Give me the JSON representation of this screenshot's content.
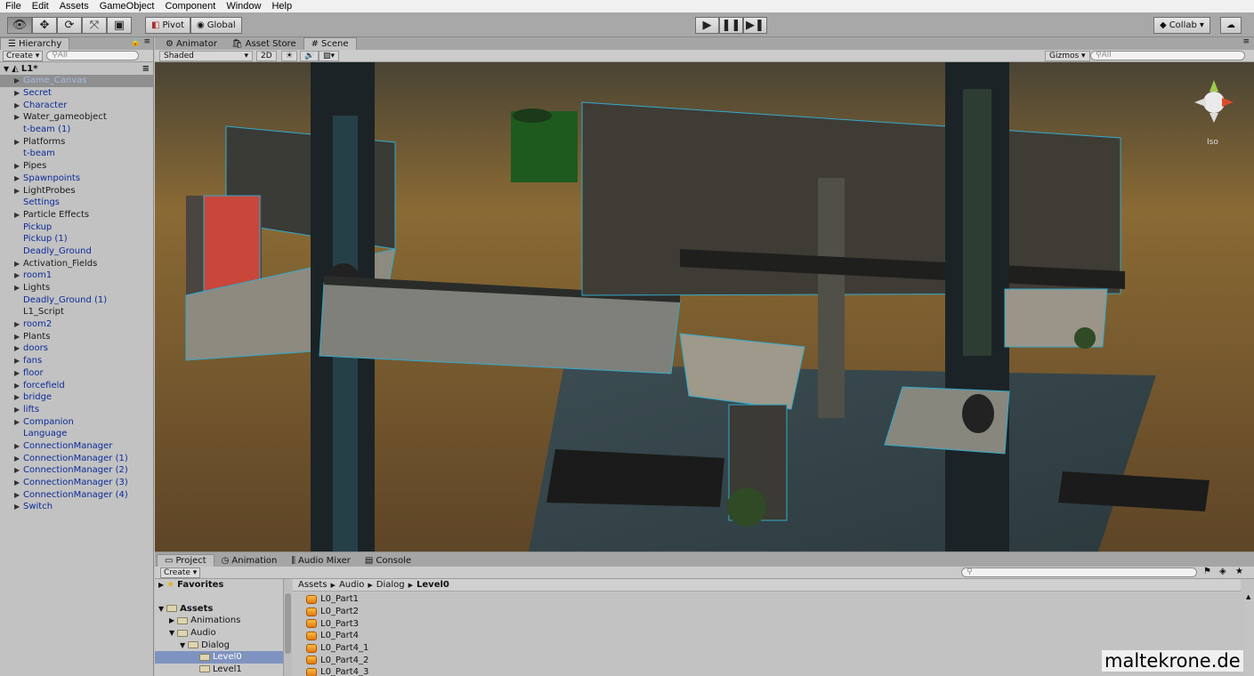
{
  "menu": [
    "File",
    "Edit",
    "Assets",
    "GameObject",
    "Component",
    "Window",
    "Help"
  ],
  "toolbar": {
    "tools": [
      "eye-icon",
      "move-icon",
      "rotate-icon",
      "scale-icon",
      "rect-icon"
    ],
    "pivot": "Pivot",
    "global": "Global",
    "collab": "Collab",
    "play_icons": [
      "play-icon",
      "pause-icon",
      "step-icon"
    ]
  },
  "hierarchy": {
    "tab": "Hierarchy",
    "create": "Create",
    "search_placeholder": "All",
    "scene_name": "L1*",
    "items": [
      {
        "label": "Game_Canvas",
        "expandable": true,
        "selected": true,
        "prefab": true
      },
      {
        "label": "Secret",
        "expandable": true,
        "prefab": true
      },
      {
        "label": "Character",
        "expandable": true,
        "prefab": true
      },
      {
        "label": "Water_gameobject",
        "expandable": true,
        "prefab": false
      },
      {
        "label": "t-beam (1)",
        "expandable": false,
        "prefab": true
      },
      {
        "label": "Platforms",
        "expandable": true,
        "prefab": false
      },
      {
        "label": "t-beam",
        "expandable": false,
        "prefab": true
      },
      {
        "label": "Pipes",
        "expandable": true,
        "prefab": false
      },
      {
        "label": "Spawnpoints",
        "expandable": true,
        "prefab": true
      },
      {
        "label": "LightProbes",
        "expandable": true,
        "prefab": false
      },
      {
        "label": "Settings",
        "expandable": false,
        "prefab": true
      },
      {
        "label": "Particle Effects",
        "expandable": true,
        "prefab": false
      },
      {
        "label": "Pickup",
        "expandable": false,
        "prefab": true
      },
      {
        "label": "Pickup (1)",
        "expandable": false,
        "prefab": true
      },
      {
        "label": "Deadly_Ground",
        "expandable": false,
        "prefab": true
      },
      {
        "label": "Activation_Fields",
        "expandable": true,
        "prefab": false
      },
      {
        "label": "room1",
        "expandable": true,
        "prefab": true
      },
      {
        "label": "Lights",
        "expandable": true,
        "prefab": false
      },
      {
        "label": "Deadly_Ground (1)",
        "expandable": false,
        "prefab": true
      },
      {
        "label": "L1_Script",
        "expandable": false,
        "prefab": false
      },
      {
        "label": "room2",
        "expandable": true,
        "prefab": true
      },
      {
        "label": "Plants",
        "expandable": true,
        "prefab": false
      },
      {
        "label": "doors",
        "expandable": true,
        "prefab": true
      },
      {
        "label": "fans",
        "expandable": true,
        "prefab": true
      },
      {
        "label": "floor",
        "expandable": true,
        "prefab": true
      },
      {
        "label": "forcefield",
        "expandable": true,
        "prefab": true
      },
      {
        "label": "bridge",
        "expandable": true,
        "prefab": true
      },
      {
        "label": "lifts",
        "expandable": true,
        "prefab": true
      },
      {
        "label": "Companion",
        "expandable": true,
        "prefab": true
      },
      {
        "label": "Language",
        "expandable": false,
        "prefab": true
      },
      {
        "label": "ConnectionManager",
        "expandable": true,
        "prefab": true
      },
      {
        "label": "ConnectionManager (1)",
        "expandable": true,
        "prefab": true
      },
      {
        "label": "ConnectionManager (2)",
        "expandable": true,
        "prefab": true
      },
      {
        "label": "ConnectionManager (3)",
        "expandable": true,
        "prefab": true
      },
      {
        "label": "ConnectionManager (4)",
        "expandable": true,
        "prefab": true
      },
      {
        "label": "Switch",
        "expandable": true,
        "prefab": true
      }
    ]
  },
  "scene": {
    "tabs": [
      "Animator",
      "Asset Store",
      "Scene"
    ],
    "shading": "Shaded",
    "mode2d": "2D",
    "gizmos": "Gizmos",
    "search_placeholder": "All",
    "iso": "Iso"
  },
  "project": {
    "tabs": [
      "Project",
      "Animation",
      "Audio Mixer",
      "Console"
    ],
    "create": "Create",
    "favorites": "Favorites",
    "tree": [
      {
        "label": "Assets",
        "bold": true
      },
      {
        "label": "Animations"
      },
      {
        "label": "Audio"
      },
      {
        "label": "Dialog"
      },
      {
        "label": "Level0",
        "selected": true
      },
      {
        "label": "Level1"
      }
    ],
    "breadcrumb": [
      "Assets",
      "Audio",
      "Dialog",
      "Level0"
    ],
    "files": [
      "L0_Part1",
      "L0_Part2",
      "L0_Part3",
      "L0_Part4",
      "L0_Part4_1",
      "L0_Part4_2",
      "L0_Part4_3"
    ]
  },
  "watermark": "maltekrone.de",
  "colors": {
    "prefab": "#0c2b9a",
    "selection": "#8f8f8f",
    "sky_top": "#5a4a2a",
    "floor": "#6b5433"
  }
}
